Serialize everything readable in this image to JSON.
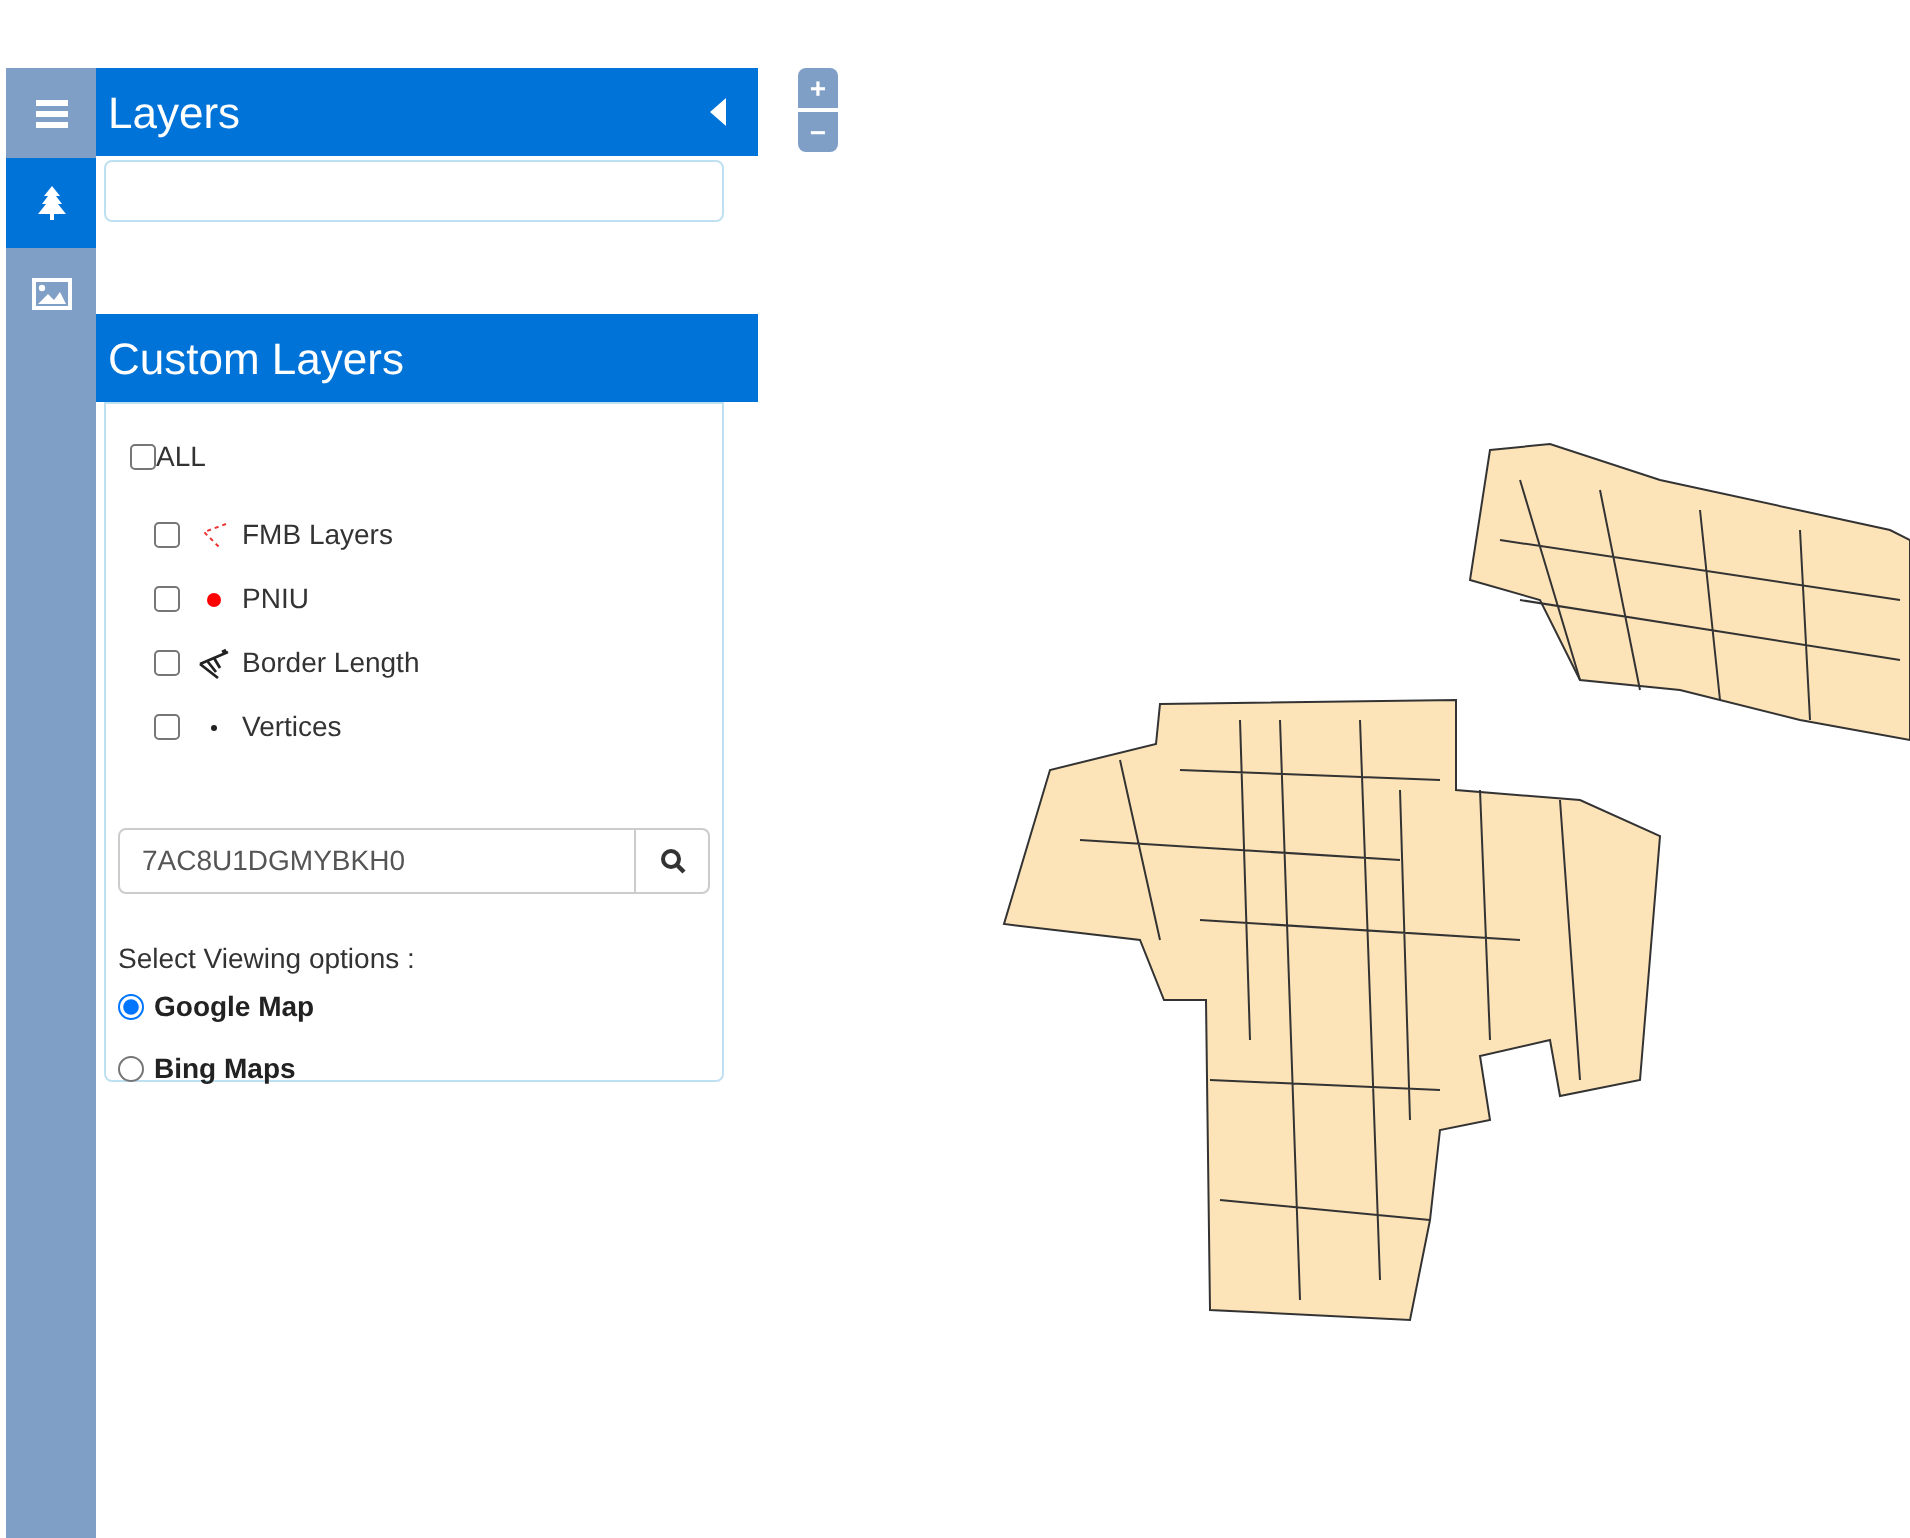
{
  "rail": [
    {
      "kind": "menu",
      "selected": false
    },
    {
      "kind": "tree",
      "selected": true
    },
    {
      "kind": "image",
      "selected": false
    }
  ],
  "layers_panel": {
    "title": "Layers"
  },
  "custom_layers": {
    "title": "Custom Layers",
    "all": {
      "label": "ALL",
      "checked": false
    },
    "layers": [
      {
        "label": "FMB Layers",
        "checked": false,
        "kind": "dashed"
      },
      {
        "label": "PNIU",
        "checked": false,
        "kind": "dot"
      },
      {
        "label": "Border Length",
        "checked": false,
        "kind": "measure"
      },
      {
        "label": "Vertices",
        "checked": false,
        "kind": "point"
      }
    ],
    "search": {
      "value": "7AC8U1DGMYBKH0"
    },
    "viewing_label": "Select Viewing options :",
    "options": [
      {
        "label": "Google Map",
        "selected": true
      },
      {
        "label": "Bing Maps",
        "selected": false
      }
    ]
  },
  "zoom": {
    "in": "+",
    "out": "−"
  }
}
